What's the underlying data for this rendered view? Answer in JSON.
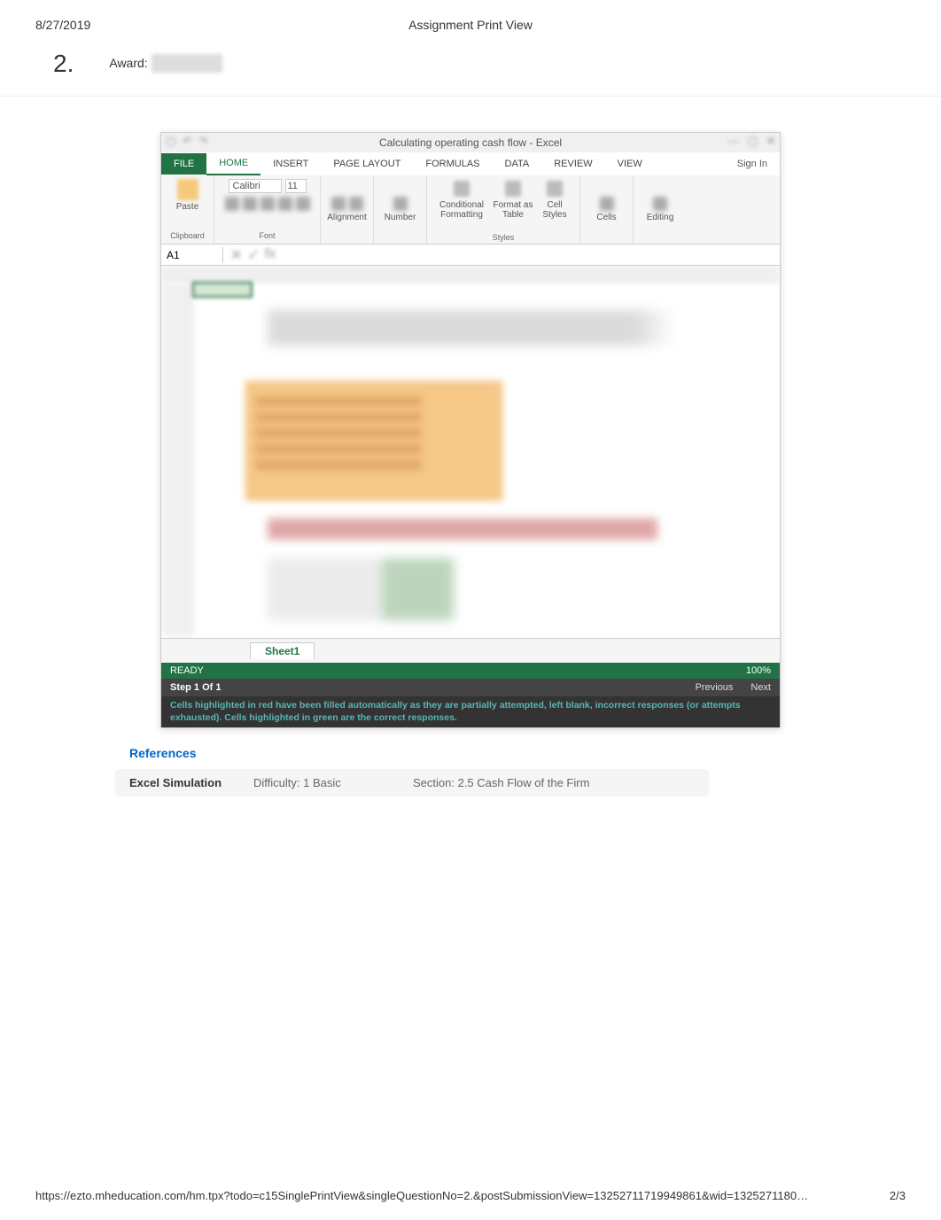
{
  "header": {
    "date": "8/27/2019",
    "title": "Assignment Print View"
  },
  "question": {
    "number": "2.",
    "award_label": "Award:"
  },
  "excel": {
    "window_title": "Calculating operating cash flow - Excel",
    "tabs": {
      "file": "FILE",
      "home": "HOME",
      "insert": "INSERT",
      "page_layout": "PAGE LAYOUT",
      "formulas": "FORMULAS",
      "data": "DATA",
      "review": "REVIEW",
      "view": "VIEW"
    },
    "signin": "Sign In",
    "ribbon": {
      "paste": "Paste",
      "clipboard": "Clipboard",
      "font_name": "Calibri",
      "font_size": "11",
      "font_label": "Font",
      "alignment": "Alignment",
      "number": "Number",
      "cond_fmt": "Conditional Formatting",
      "fmt_table": "Format as Table",
      "cell_styles": "Cell Styles",
      "styles_label": "Styles",
      "cells": "Cells",
      "editing": "Editing"
    },
    "namebox": "A1",
    "sheet_tab": "Sheet1",
    "status_ready": "READY",
    "zoom": "100%",
    "step_label": "Step 1 Of 1",
    "nav_prev": "Previous",
    "nav_next": "Next",
    "hint": "Cells highlighted in red have been filled automatically as they are partially attempted, left blank, incorrect responses (or attempts exhausted). Cells highlighted in green are the correct responses."
  },
  "references_label": "References",
  "meta": {
    "type": "Excel Simulation",
    "difficulty": "Difficulty: 1 Basic",
    "section": "Section: 2.5 Cash Flow of the Firm"
  },
  "footer": {
    "url": "https://ezto.mheducation.com/hm.tpx?todo=c15SinglePrintView&singleQuestionNo=2.&postSubmissionView=13252711719949861&wid=1325271180…",
    "page": "2/3"
  }
}
